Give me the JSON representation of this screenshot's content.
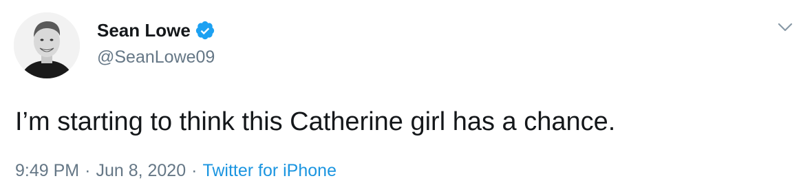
{
  "tweet": {
    "author": {
      "display_name": "Sean Lowe",
      "handle": "@SeanLowe09",
      "verified": true,
      "avatar_icon": "profile-photo"
    },
    "text": "I’m starting to think this Catherine girl has a chance.",
    "meta": {
      "time": "9:49 PM",
      "date": "Jun 8, 2020",
      "separator": "·",
      "source": "Twitter for iPhone"
    },
    "menu_icon": "chevron-down-icon"
  },
  "colors": {
    "text": "#14171a",
    "secondary": "#657786",
    "link": "#1b95e0",
    "verified": "#1da1f2"
  }
}
